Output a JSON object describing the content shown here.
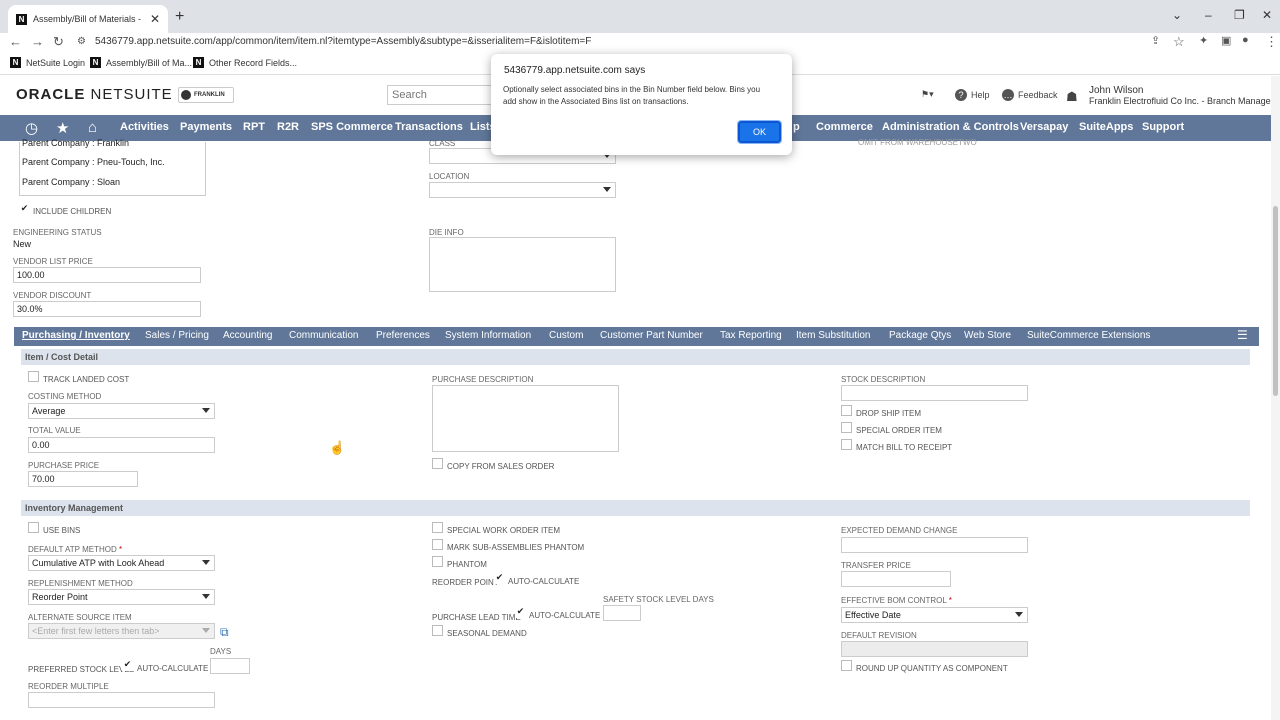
{
  "browser": {
    "tab_title": "Assembly/Bill of Materials - NetS",
    "url": "5436779.app.netsuite.com/app/common/item/item.nl?itemtype=Assembly&subtype=&isserialitem=F&islotitem=F",
    "bookmarks": [
      "NetSuite Login",
      "Assembly/Bill of Ma...",
      "Other Record Fields..."
    ]
  },
  "header": {
    "logo_oracle": "ORACLE",
    "logo_netsuite": "NETSUITE",
    "brand_badge": "FRANKLIN",
    "search_placeholder": "Search",
    "help": "Help",
    "feedback": "Feedback",
    "user_name": "John Wilson",
    "user_role": "Franklin Electrofluid Co Inc. - Branch Manager"
  },
  "menu": [
    "Activities",
    "Payments",
    "RPT",
    "R2R",
    "SPS Commerce",
    "Transactions",
    "Lists",
    "p",
    "Commerce",
    "Administration & Controls",
    "Versapay",
    "SuiteApps",
    "Support"
  ],
  "top_form": {
    "parent_companies": [
      "Parent Company : Franklin",
      "Parent Company : Pneu-Touch, Inc.",
      "Parent Company : Sloan"
    ],
    "include_children": "INCLUDE CHILDREN",
    "engineering_status_label": "ENGINEERING STATUS",
    "engineering_status": "New",
    "vendor_list_price_label": "VENDOR LIST PRICE",
    "vendor_list_price": "100.00",
    "vendor_discount_label": "VENDOR DISCOUNT",
    "vendor_discount": "30.0%",
    "class_label": "CLASS",
    "location_label": "LOCATION",
    "die_info_label": "DIE INFO",
    "omit_label": "OMIT FROM WAREHOUSETWO"
  },
  "subtabs": [
    "Purchasing / Inventory",
    "Sales / Pricing",
    "Accounting",
    "Communication",
    "Preferences",
    "System Information",
    "Custom",
    "Customer Part Number",
    "Tax Reporting",
    "Item Substitution",
    "Package Qtys",
    "Web Store",
    "SuiteCommerce Extensions"
  ],
  "cost_detail": {
    "title": "Item / Cost Detail",
    "track_landed_cost": "TRACK LANDED COST",
    "costing_method_label": "COSTING METHOD",
    "costing_method": "Average",
    "total_value_label": "TOTAL VALUE",
    "total_value": "0.00",
    "purchase_price_label": "PURCHASE PRICE",
    "purchase_price": "70.00",
    "purchase_description_label": "PURCHASE DESCRIPTION",
    "copy_from_sales_order": "COPY FROM SALES ORDER",
    "stock_description_label": "STOCK DESCRIPTION",
    "drop_ship_item": "DROP SHIP ITEM",
    "special_order_item": "SPECIAL ORDER ITEM",
    "match_bill_to_receipt": "MATCH BILL TO RECEIPT"
  },
  "inventory": {
    "title": "Inventory Management",
    "use_bins": "USE BINS",
    "default_atp_label": "DEFAULT ATP METHOD",
    "required_mark": "*",
    "default_atp": "Cumulative ATP with Look Ahead",
    "replenishment_label": "REPLENISHMENT METHOD",
    "replenishment": "Reorder Point",
    "alt_source_label": "ALTERNATE SOURCE ITEM",
    "alt_source_placeholder": "<Enter first few letters then tab>",
    "days_label": "DAYS",
    "preferred_stock_label": "PREFERRED STOCK LEVEL",
    "auto_calculate": "AUTO-CALCULATE",
    "reorder_multiple_label": "REORDER MULTIPLE",
    "special_work_order": "SPECIAL WORK ORDER ITEM",
    "mark_sub_assemblies": "MARK SUB-ASSEMBLIES PHANTOM",
    "phantom": "PHANTOM",
    "reorder_point_label": "REORDER POINT",
    "safety_stock_label": "SAFETY STOCK LEVEL DAYS",
    "purchase_lead_time_label": "PURCHASE LEAD TIME",
    "seasonal_demand": "SEASONAL DEMAND",
    "expected_demand_label": "EXPECTED DEMAND CHANGE",
    "transfer_price_label": "TRANSFER PRICE",
    "effective_bom_label": "EFFECTIVE BOM CONTROL",
    "effective_bom": "Effective Date",
    "default_revision_label": "DEFAULT REVISION",
    "round_up": "ROUND UP QUANTITY AS COMPONENT"
  },
  "dialog": {
    "title": "5436779.app.netsuite.com says",
    "message": "Optionally select associated bins in the Bin Number field below. Bins you add show in the Associated Bins list on transactions.",
    "ok": "OK"
  }
}
